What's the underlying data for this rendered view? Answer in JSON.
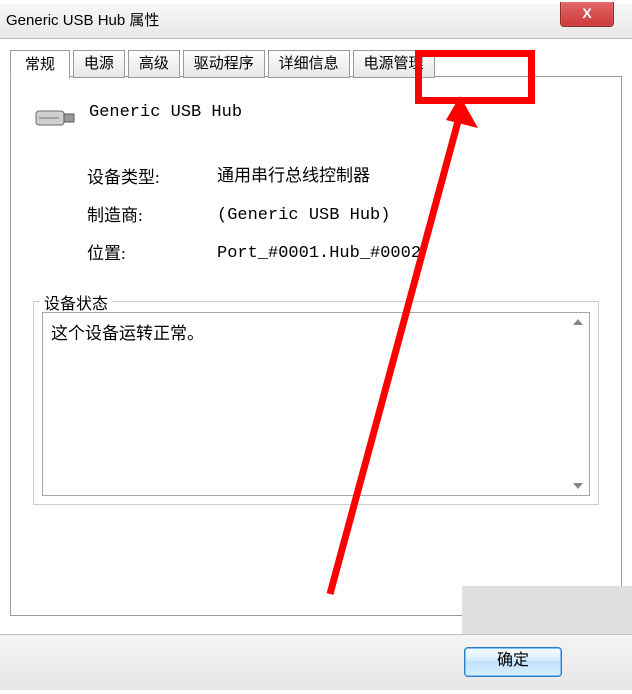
{
  "window": {
    "title": "Generic USB Hub 属性",
    "close_glyph": "X"
  },
  "tabs": {
    "general": "常规",
    "power": "电源",
    "advanced": "高级",
    "driver": "驱动程序",
    "details": "详细信息",
    "powermgmt": "电源管理"
  },
  "device": {
    "name": "Generic USB Hub",
    "type_label": "设备类型:",
    "type_value": "通用串行总线控制器",
    "mfr_label": "制造商:",
    "mfr_value": "(Generic USB Hub)",
    "loc_label": "位置:",
    "loc_value": "Port_#0001.Hub_#0002"
  },
  "status": {
    "legend": "设备状态",
    "text": "这个设备运转正常。"
  },
  "buttons": {
    "ok": "确定"
  },
  "annotation": {
    "highlight_target": "tabs.powermgmt",
    "highlight_color": "#ff0000"
  }
}
